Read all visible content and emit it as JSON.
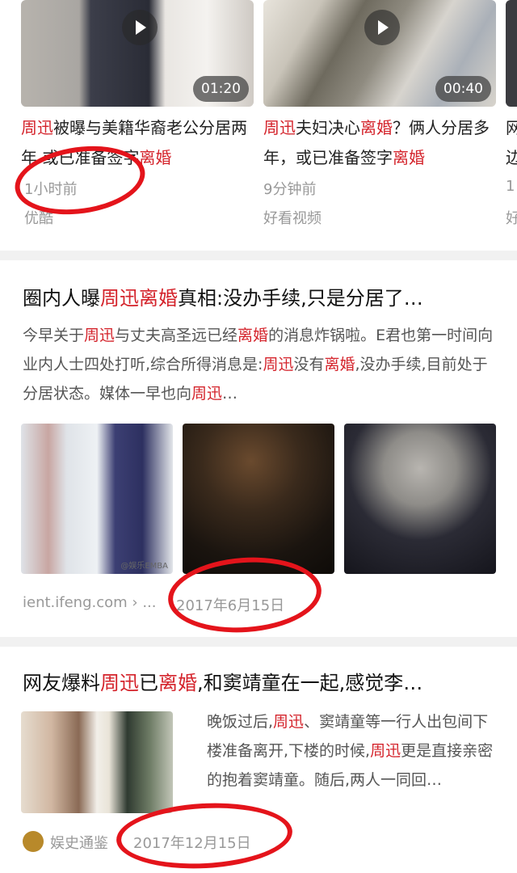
{
  "videos": [
    {
      "duration": "01:20",
      "title_parts": [
        {
          "t": "周迅",
          "red": true
        },
        {
          "t": "被曝与美籍华裔老公分居两年 或已准备签字",
          "red": false
        },
        {
          "t": "离婚",
          "red": true
        }
      ],
      "time": "1小时前",
      "source": "优酷"
    },
    {
      "duration": "00:40",
      "title_parts": [
        {
          "t": "周迅",
          "red": true
        },
        {
          "t": "夫妇决心",
          "red": false
        },
        {
          "t": "离婚",
          "red": true
        },
        {
          "t": "？俩人分居多年，或已准备签字",
          "red": false
        },
        {
          "t": "离婚",
          "red": true
        }
      ],
      "time": "9分钟前",
      "source": "好看视频"
    },
    {
      "title_parts": [
        {
          "t": "网边",
          "red": false
        }
      ],
      "time": "1",
      "source": "好"
    }
  ],
  "article1": {
    "title_parts": [
      {
        "t": "圈内人曝",
        "red": false
      },
      {
        "t": "周迅离婚",
        "red": true
      },
      {
        "t": "真相:没办手续,只是分居了…",
        "red": false
      }
    ],
    "body_parts": [
      {
        "t": "今早关于",
        "red": false
      },
      {
        "t": "周迅",
        "red": true
      },
      {
        "t": "与丈夫高圣远已经",
        "red": false
      },
      {
        "t": "离婚",
        "red": true
      },
      {
        "t": "的消息炸锅啦。E君也第一时间向业内人士四处打听,综合所得消息是:",
        "red": false
      },
      {
        "t": "周迅",
        "red": true
      },
      {
        "t": "没有",
        "red": false
      },
      {
        "t": "离婚",
        "red": true
      },
      {
        "t": ",没办手续,目前处于分居状态。媒体一早也向",
        "red": false
      },
      {
        "t": "周迅",
        "red": true
      },
      {
        "t": "…",
        "red": false
      }
    ],
    "source": "ient.ifeng.com › ...",
    "date": "2017年6月15日",
    "watermark": "@娱乐EMBA"
  },
  "article2": {
    "title_parts": [
      {
        "t": "网友爆料",
        "red": false
      },
      {
        "t": "周迅",
        "red": true
      },
      {
        "t": "已",
        "red": false
      },
      {
        "t": "离婚",
        "red": true
      },
      {
        "t": ",和窦靖童在一起,感觉李…",
        "red": false
      }
    ],
    "body_parts": [
      {
        "t": "晚饭过后,",
        "red": false
      },
      {
        "t": "周迅",
        "red": true
      },
      {
        "t": "、窦靖童等一行人出包间下楼准备离开,下楼的时候,",
        "red": false
      },
      {
        "t": "周迅",
        "red": true
      },
      {
        "t": "更是直接亲密的抱着窦靖童。随后,两人一同回…",
        "red": false
      }
    ],
    "source": "娱史通鉴",
    "date": "2017年12月15日"
  },
  "colors": {
    "highlight": "#d4232b",
    "annotation": "#e4141b",
    "meta": "#999999",
    "divider": "#f1f1f1"
  }
}
